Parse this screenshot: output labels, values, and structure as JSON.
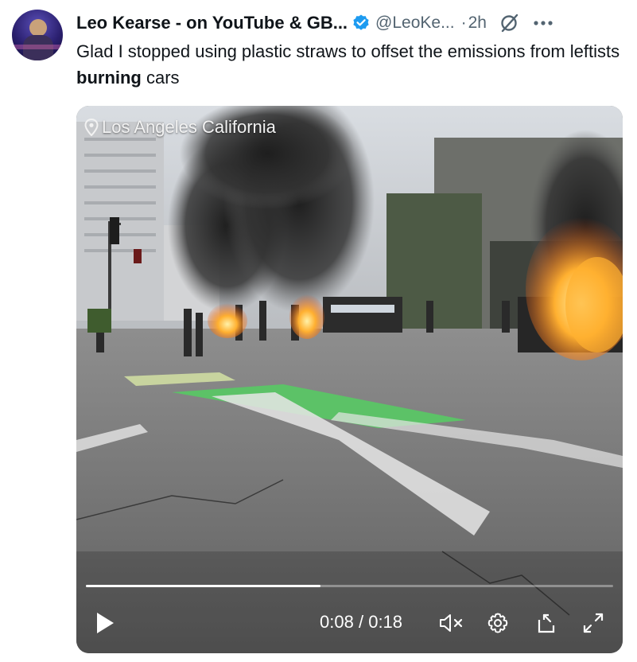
{
  "tweet": {
    "author_name": "Leo Kearse - on YouTube & GB...",
    "handle": "@LeoKe...",
    "separator": "·",
    "time": "2h",
    "text_before": "Glad I stopped using plastic straws to offset the emissions from leftists ",
    "text_bold": "burning",
    "text_after": " cars",
    "verified_color": "#1d9bf0"
  },
  "media": {
    "location_label": "Los Angeles California",
    "current_time": "0:08",
    "time_separator": "/",
    "duration": "0:18",
    "progress_fraction": 0.4444,
    "icons": {
      "play": "play-icon",
      "mute": "mute-icon",
      "settings": "settings-gear-icon",
      "pip": "picture-in-picture-icon",
      "fullscreen": "fullscreen-icon",
      "location": "location-pin-icon"
    }
  },
  "icons": {
    "avatar": "avatar",
    "verified": "verified-badge-icon",
    "grok": "grok-icon",
    "more": "more-options-icon"
  }
}
